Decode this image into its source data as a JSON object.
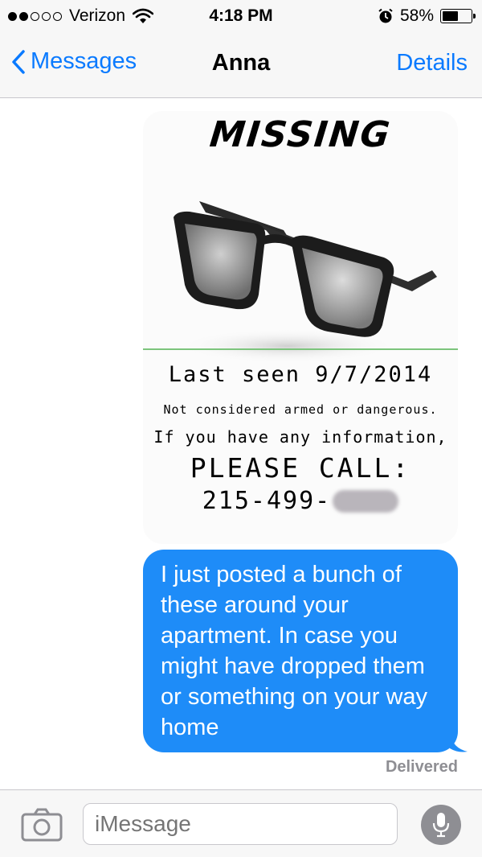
{
  "status_bar": {
    "signal_bars_filled": 2,
    "signal_bars_total": 5,
    "carrier": "Verizon",
    "time": "4:18 PM",
    "battery_percent": "58%",
    "battery_level": 0.58
  },
  "nav": {
    "back_label": "Messages",
    "title": "Anna",
    "details_label": "Details"
  },
  "poster": {
    "title": "MISSING",
    "last_seen": "Last seen 9/7/2014",
    "note": "Not considered armed or dangerous.",
    "info": "If you have any information,",
    "call": "PLEASE CALL:",
    "phone_visible": "215-499-"
  },
  "message": {
    "text": "I just posted a bunch of these around your apartment. In case you might have dropped them or something on your way home",
    "status": "Delivered"
  },
  "input": {
    "placeholder": "iMessage"
  },
  "colors": {
    "accent": "#0a7aff",
    "sent_bubble": "#1e8cf8",
    "delivered_text": "#8e8e93"
  },
  "icons": [
    "chevron-left-icon",
    "wifi-icon",
    "alarm-icon",
    "battery-icon",
    "glasses-icon",
    "camera-icon",
    "microphone-icon"
  ]
}
